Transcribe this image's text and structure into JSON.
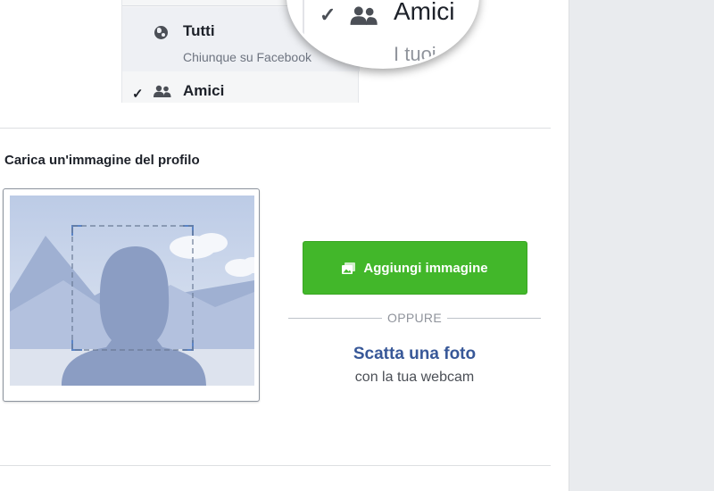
{
  "privacy_menu": {
    "options": [
      {
        "label": "Tutti",
        "sublabel": "Chiunque su Facebook",
        "icon": "globe-icon"
      },
      {
        "label": "Amici",
        "icon": "friends-icon",
        "selected": true
      }
    ]
  },
  "magnifier": {
    "label": "Amici",
    "sublabel": "I tuoi",
    "icon": "friends-icon"
  },
  "profile_picture": {
    "section_title": "Carica un'immagine del profilo",
    "add_button_label": "Aggiungi immagine",
    "divider_text": "OPPURE",
    "webcam_link": "Scatta una foto",
    "webcam_subtext": "con la tua webcam"
  },
  "colors": {
    "accent_green": "#42b72a",
    "link_blue": "#385898",
    "placeholder_blue": "#8b9dc3"
  }
}
